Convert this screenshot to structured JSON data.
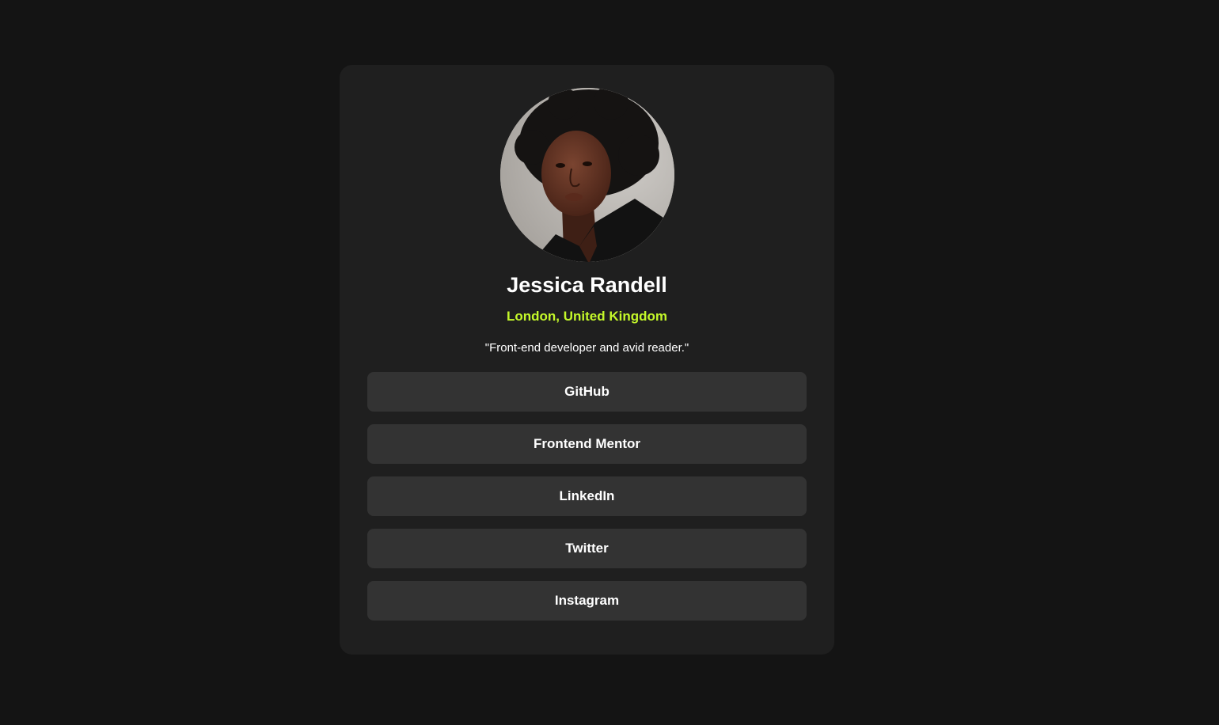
{
  "profile": {
    "name": "Jessica Randell",
    "location": "London, United Kingdom",
    "bio": "\"Front-end developer and avid reader.\""
  },
  "links": [
    {
      "label": "GitHub"
    },
    {
      "label": "Frontend Mentor"
    },
    {
      "label": "LinkedIn"
    },
    {
      "label": "Twitter"
    },
    {
      "label": "Instagram"
    }
  ],
  "colors": {
    "page_background": "#141414",
    "card_background": "#1f1f1f",
    "button_background": "#333333",
    "accent": "#c4f82a",
    "text": "#ffffff"
  }
}
